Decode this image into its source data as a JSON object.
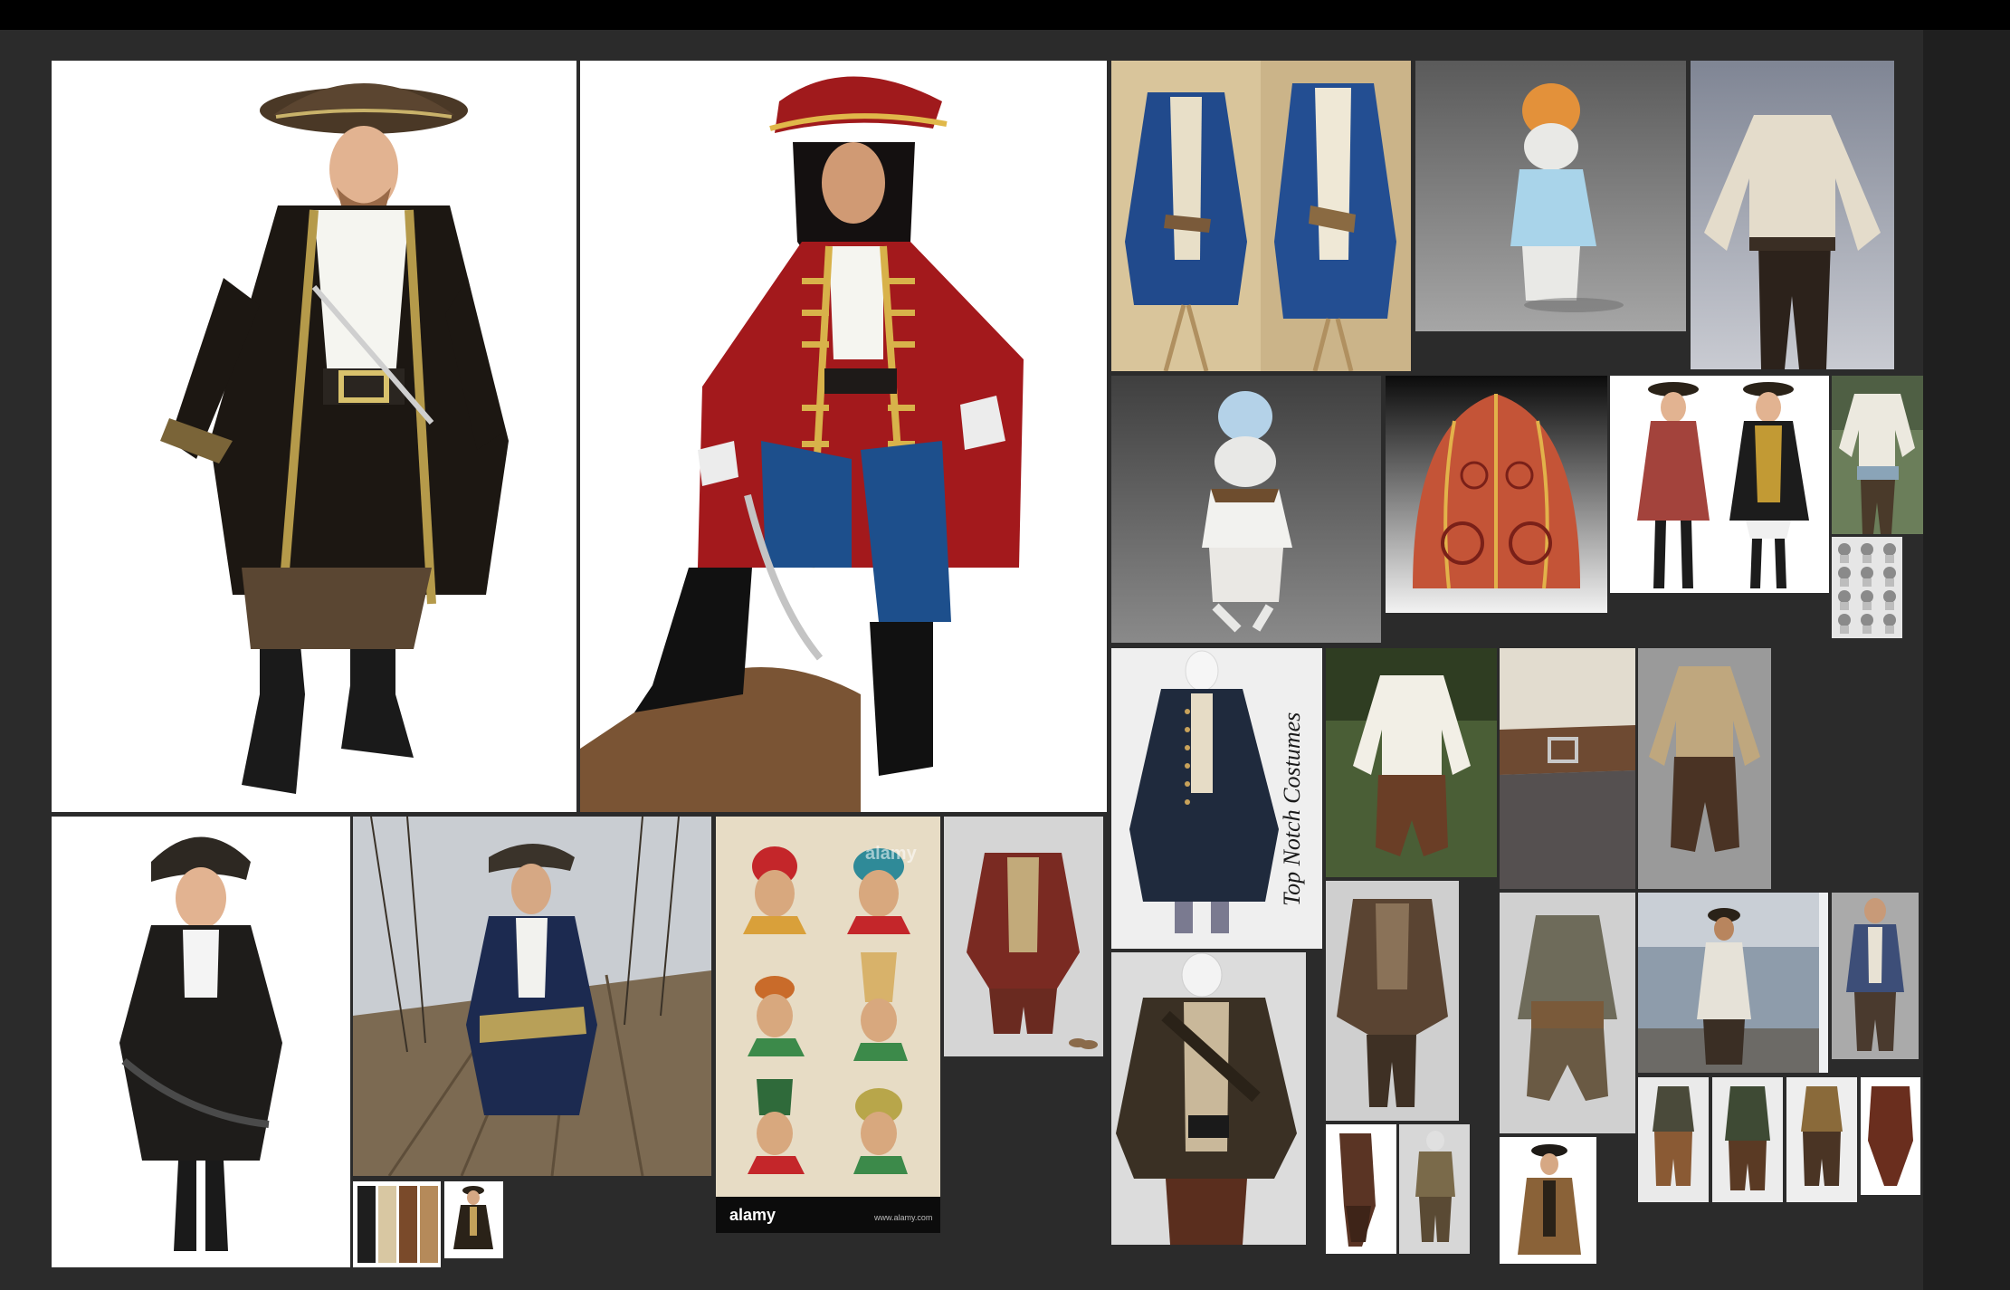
{
  "board": {
    "background": "#2b2b2b",
    "topbar_color": "#000000",
    "sidebar_color": "#1f1f1f"
  },
  "tiles": {
    "black_pirate_coat": {
      "bg": "#ffffff",
      "coat": "#1c1712",
      "trim": "#b59a4a"
    },
    "red_pirate_coat": {
      "bg": "#ffffff",
      "coat": "#a3191c",
      "trim": "#d8b24a"
    },
    "blue_frock_coats": {
      "bg": "#d8c49a",
      "coat": "#214a8c"
    },
    "hamster_model_blue": {
      "bg": "#777777",
      "shirt": "#a9d4ea",
      "turban": "#e3913a"
    },
    "cream_shirt": {
      "bg": "#a4a8b4",
      "shirt": "#e4dccb"
    },
    "hamster_model_white": {
      "bg": "#5a5a5a",
      "turban": "#b4d2e8"
    },
    "embroidered_cap": {
      "bg": "#0f0f0f",
      "cap": "#c45437"
    },
    "two_pirate_women": {
      "bg": "#ffffff"
    },
    "sash_outfit": {
      "bg": "#6b7e5a"
    },
    "turban_sketches": {
      "bg": "#e6e6e6"
    },
    "navy_justaucorps": {
      "bg": "#efefef",
      "watermark": "Top Notch Costumes"
    },
    "forest_blouse": {
      "bg": "#4a5e36"
    },
    "leather_belt": {
      "bg": "#a2a2a2"
    },
    "tan_shirt_breeches": {
      "bg": "#9a9a9a"
    },
    "child_pirate": {
      "bg": "#ffffff"
    },
    "ship_deck_pirate": {
      "bg": "#7c6a52"
    },
    "turban_heads_print": {
      "bg": "#e7dcc5",
      "watermark": "alamy",
      "footer": "alamy",
      "footer_url": "www.alamy.com"
    },
    "vest_costume": {
      "bg": "#d3d3d3"
    },
    "brown_layered_rags": {
      "bg": "#cfcfcf"
    },
    "green_sack_costume": {
      "bg": "#d0d0d0"
    },
    "olive_coat_belts": {
      "bg": "#d8d8d8"
    },
    "jack_sparrow_still": {
      "bg": "#8e9cab"
    },
    "blue_vest_figure": {
      "bg": "#aaaaaa"
    },
    "pants_swatches": {
      "bg": "#ffffff"
    },
    "mini_coat": {
      "bg": "#ffffff"
    },
    "brown_pants_pair": {
      "bg": "#ffffff"
    },
    "small_pirate_tricorn": {
      "bg": "#ffffff"
    },
    "breeches_row": {
      "bg": "#ffffff"
    }
  }
}
